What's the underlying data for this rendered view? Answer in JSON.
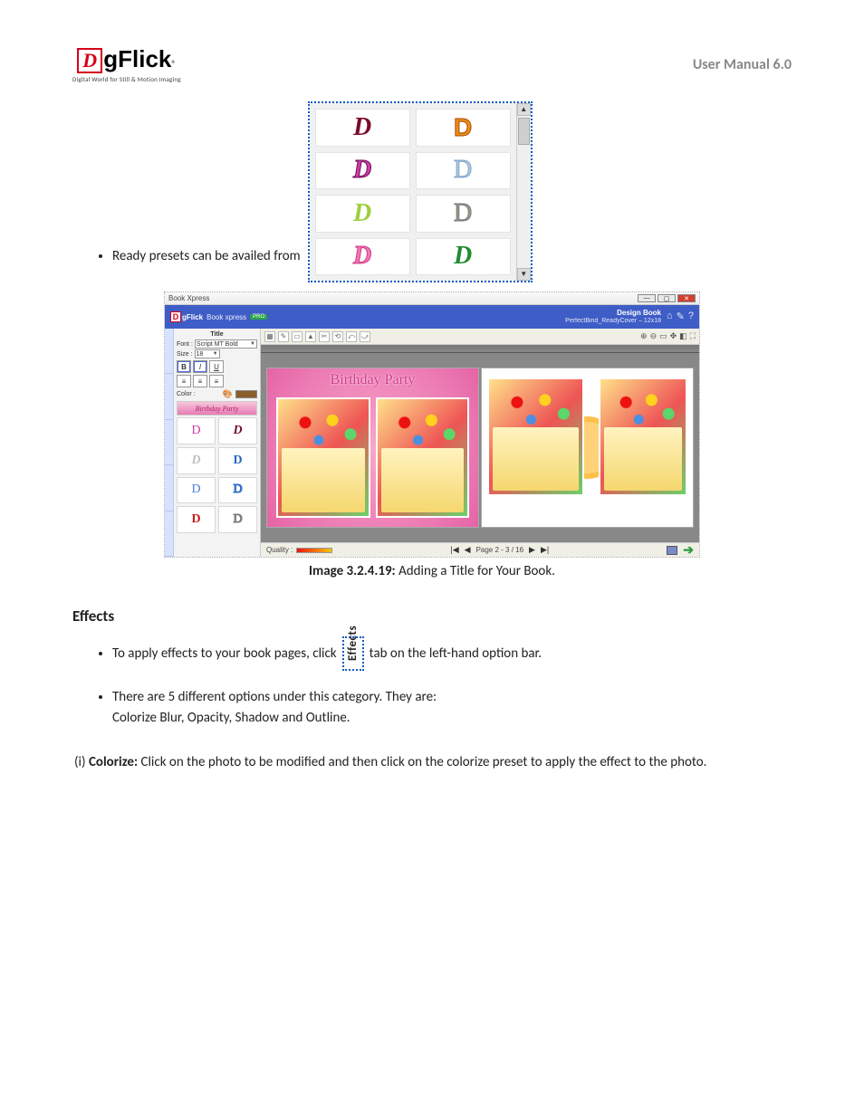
{
  "header": {
    "logo_letter": "D",
    "logo_rest_g": "g",
    "logo_rest_flick": "Flick",
    "logo_reg": "®",
    "tagline": "Digital World for Still & Motion Imaging",
    "right": "User Manual 6.0"
  },
  "bullet_presets": "Ready presets can be availed from",
  "preset_letters": [
    "D",
    "D",
    "D",
    "D",
    "D",
    "D",
    "D",
    "D"
  ],
  "preset_styles": [
    {
      "c": "#7a0a28",
      "fs": "italic",
      "fw": "900",
      "ff": "Georgia, serif"
    },
    {
      "c": "#f28c1a",
      "fs": "normal",
      "fw": "900",
      "ff": "Arial Black, sans-serif",
      "outline": "#a04a00"
    },
    {
      "c": "#d23aa8",
      "fs": "italic",
      "fw": "900",
      "ff": "Georgia, serif",
      "outline": "#6a1158"
    },
    {
      "c": "#b6c9df",
      "fs": "normal",
      "fw": "400",
      "ff": "Georgia, serif",
      "outline": "#7ea4cc"
    },
    {
      "c": "#9dcf3f",
      "fs": "italic",
      "fw": "700",
      "ff": "'Brush Script MT', cursive"
    },
    {
      "c": "#9aa087",
      "fs": "normal",
      "fw": "400",
      "ff": "Georgia, serif",
      "outline": "#777"
    },
    {
      "c": "#f178b4",
      "fs": "italic",
      "fw": "700",
      "ff": "'Brush Script MT', cursive",
      "outline": "#d23a8a"
    },
    {
      "c": "#1f8b2e",
      "fs": "italic",
      "fw": "900",
      "ff": "Georgia, serif"
    }
  ],
  "app": {
    "window_title": "Book Xpress",
    "product": "Book xpress",
    "product_badge": "PRO",
    "design_label": "Design Book",
    "path": "PerfectBind_ReadyCover – 12x18",
    "side": {
      "tab": "Title",
      "font_label": "Font :",
      "font_value": "Script MT Bold",
      "size_label": "Size :",
      "size_value": "18",
      "bold": "B",
      "italic": "I",
      "underline": "U",
      "color_label": "Color :",
      "color_hex": "#8a5e2a",
      "preview_text": "Birthday Party",
      "mini": [
        {
          "txt": "D",
          "c": "#d23aa8",
          "fs": "normal",
          "fw": "400"
        },
        {
          "txt": "D",
          "c": "#7a0a28",
          "fs": "italic",
          "fw": "900"
        },
        {
          "txt": "D",
          "c": "#bfbfbf",
          "fs": "italic",
          "fw": "700"
        },
        {
          "txt": "D",
          "c": "#2a66c4",
          "fs": "normal",
          "fw": "700"
        },
        {
          "txt": "D",
          "c": "#4a7fd6",
          "fs": "normal",
          "fw": "400"
        },
        {
          "txt": "D",
          "c": "#6aa5e8",
          "fs": "normal",
          "fw": "400",
          "outline": "#2a66c4"
        },
        {
          "txt": "D",
          "c": "#c81e1e",
          "fs": "normal",
          "fw": "900"
        },
        {
          "txt": "D",
          "c": "#9aa087",
          "fs": "normal",
          "fw": "400",
          "outline": "#777"
        }
      ]
    },
    "canvas_title": "Birthday Party",
    "quality_label": "Quality :",
    "pager": {
      "first": "|◀",
      "prev": "◀",
      "label": "Page 2 - 3 / 16",
      "next": "▶",
      "last": "▶|"
    },
    "top_icons": {
      "home": "⌂",
      "tool": "✎",
      "help": "?"
    },
    "view_icons": [
      "⊕",
      "⊖",
      "▭",
      "✥",
      "◧",
      "⛶"
    ]
  },
  "caption": {
    "label": "Image 3.2.4.19:",
    "text": " Adding a Title for Your Book."
  },
  "effects": {
    "heading": "Effects",
    "bullet1_a": "To apply effects to your book pages, click",
    "tab_label": "Effects",
    "bullet1_b": "tab on the left-hand option bar.",
    "bullet2_a": "There are 5 different options under this category. They are:",
    "bullet2_b": "Colorize Blur, Opacity, Shadow and Outline.",
    "colorize_num": "(i) ",
    "colorize_label": "Colorize:",
    "colorize_text": " Click on the photo to be modified and then click on the colorize preset to apply the effect to the photo."
  }
}
